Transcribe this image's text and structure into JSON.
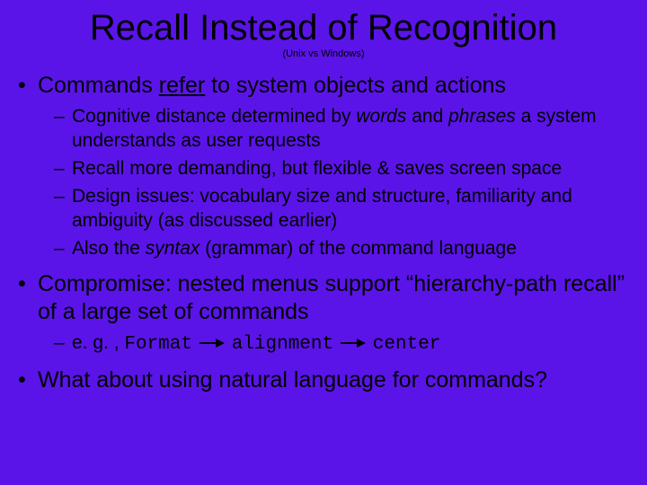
{
  "title": "Recall Instead of Recognition",
  "subtitle": "(Unix vs Windows)",
  "b1": {
    "pre": "Commands ",
    "refer": "refer",
    "post": " to system objects and actions",
    "s1": {
      "pre": "Cognitive distance determined by ",
      "words": "words",
      "mid": " and ",
      "phrases": "phrases",
      "post": " a system understands as user requests"
    },
    "s2": "Recall more demanding, but flexible & saves screen space",
    "s3": "Design issues: vocabulary size and structure, familiarity and ambiguity (as discussed earlier)",
    "s4": {
      "pre": "Also the ",
      "syntax": "syntax",
      "post": " (grammar) of the command language"
    }
  },
  "b2": {
    "text": "Compromise: nested menus support “hierarchy-path recall” of a large set of commands",
    "s1": {
      "pre": "e. g. , ",
      "p1": "Format",
      "p2": "alignment",
      "p3": "center"
    }
  },
  "b3": "What about using natural language for commands?"
}
